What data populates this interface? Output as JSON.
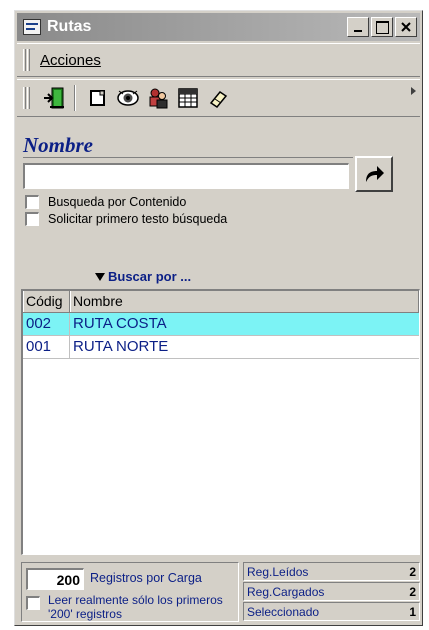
{
  "window": {
    "title": "Rutas"
  },
  "menu": {
    "items": [
      "Acciones"
    ]
  },
  "toolbar": {
    "icons": [
      "exit-door-icon",
      "new-document-icon",
      "view-eye-icon",
      "users-icon",
      "grid-table-icon",
      "eraser-icon"
    ]
  },
  "search": {
    "label": "Nombre",
    "value": "",
    "placeholder": ""
  },
  "options": {
    "contenido": "Busqueda por Contenido",
    "primero": "Solicitar primero testo búsqueda"
  },
  "buscar_por": "Buscar por ...",
  "grid": {
    "columns": [
      "Códig",
      "Nombre"
    ],
    "rows": [
      {
        "code": "002",
        "name": "RUTA COSTA",
        "selected": true
      },
      {
        "code": "001",
        "name": "RUTA NORTE",
        "selected": false
      }
    ]
  },
  "footer": {
    "registros_value": "200",
    "registros_label": "Registros por Carga",
    "leer_label": "Leer realmente sólo los primeros '200' registros",
    "stats": [
      {
        "label": "Reg.Leídos",
        "value": "2"
      },
      {
        "label": "Reg.Cargados",
        "value": "2"
      },
      {
        "label": "Seleccionado",
        "value": "1"
      }
    ]
  },
  "colors": {
    "selected_row": "#7cf3f5",
    "text_blue": "#0b1f86"
  }
}
